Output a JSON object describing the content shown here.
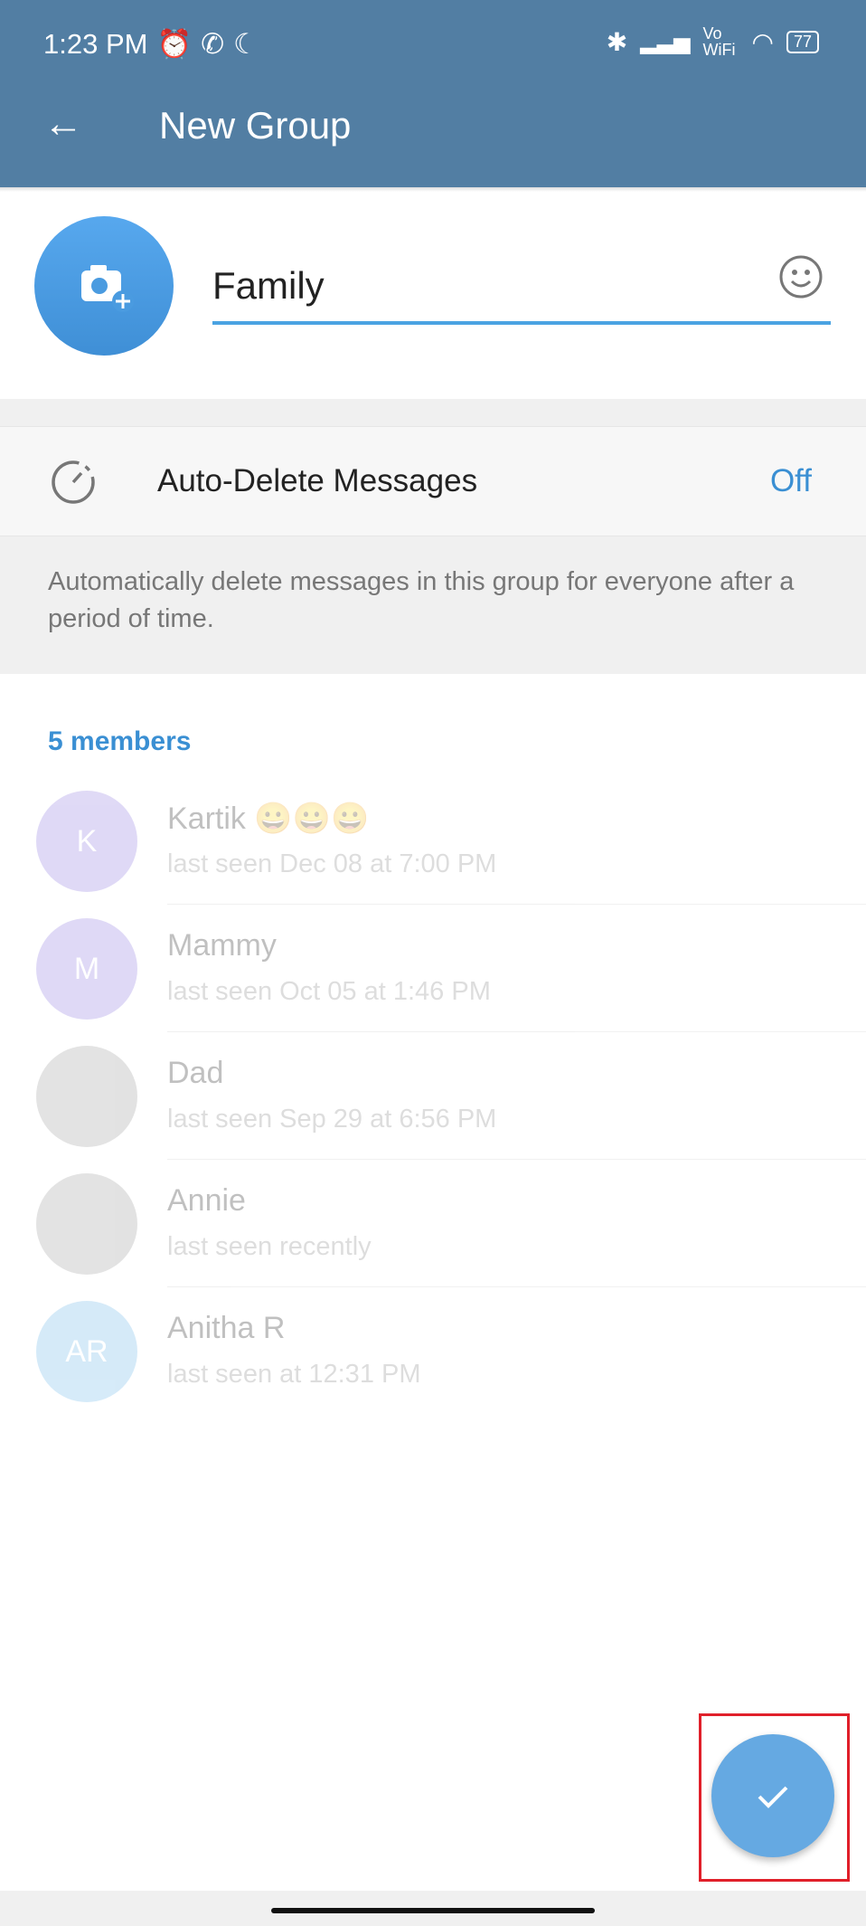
{
  "status_bar": {
    "time": "1:23 PM",
    "battery": "77",
    "network_label": "Vo WiFi"
  },
  "header": {
    "title": "New Group"
  },
  "group": {
    "name": "Family"
  },
  "auto_delete": {
    "label": "Auto-Delete Messages",
    "value": "Off",
    "description": "Automatically delete messages in this group for everyone after a period of time."
  },
  "members": {
    "count_label": "5 members",
    "items": [
      {
        "initials": "K",
        "name": "Kartik 😀😀😀",
        "status": "last seen Dec 08 at 7:00 PM",
        "color": "#8e7be0"
      },
      {
        "initials": "M",
        "name": "Mammy",
        "status": "last seen Oct 05 at 1:46 PM",
        "color": "#8e7be0"
      },
      {
        "initials": "",
        "name": "Dad",
        "status": "last seen Sep 29 at 6:56 PM",
        "color": "#999999"
      },
      {
        "initials": "",
        "name": "Annie",
        "status": "last seen recently",
        "color": "#999999"
      },
      {
        "initials": "AR",
        "name": "Anitha R",
        "status": "last seen at 12:31 PM",
        "color": "#6bb7e8"
      }
    ]
  },
  "colors": {
    "header": "#527ea3",
    "accent": "#3a8fd3",
    "fab": "#65a9e2"
  }
}
